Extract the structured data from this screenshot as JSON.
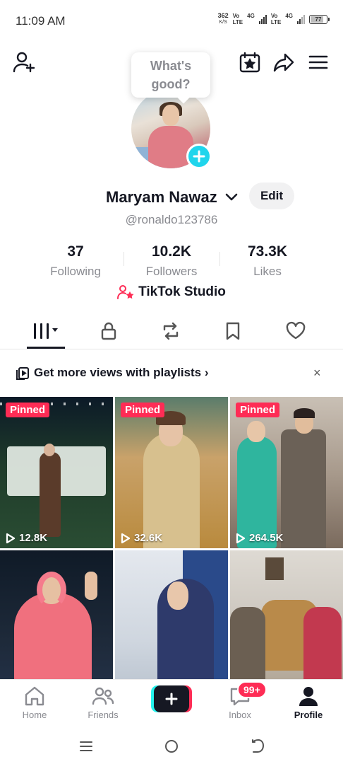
{
  "status_bar": {
    "time": "11:09 AM",
    "net_speed_value": "362",
    "net_speed_unit": "K/S",
    "sim1_label_top": "Vo",
    "sim1_label_bottom": "LTE",
    "sim1_network": "4G",
    "sim2_label_top": "Vo",
    "sim2_label_bottom": "LTE",
    "sim2_network": "4G",
    "battery_level": "77"
  },
  "header": {
    "left_icon": "add-friend-icon",
    "right_icons": [
      "calendar-star-icon",
      "share-icon",
      "menu-icon"
    ]
  },
  "profile": {
    "bubble_text_line1": "What's",
    "bubble_text_line2": "good?",
    "name": "Maryam Nawaz",
    "edit_label": "Edit",
    "handle": "@ronaldo123786",
    "stats": [
      {
        "value": "37",
        "label": "Following"
      },
      {
        "value": "10.2K",
        "label": "Followers"
      },
      {
        "value": "73.3K",
        "label": "Likes"
      }
    ],
    "studio_label": "TikTok Studio"
  },
  "tabs": [
    "videos-tab",
    "private-tab",
    "reposts-tab",
    "favorites-tab",
    "liked-tab"
  ],
  "banner": {
    "text": "Get more views with playlists",
    "chevron": "›",
    "close": "×"
  },
  "videos": [
    {
      "pinned_label": "Pinned",
      "views": "12.8K",
      "accent": "#1f3b2a"
    },
    {
      "pinned_label": "Pinned",
      "views": "32.6K",
      "accent": "#b98a3d"
    },
    {
      "pinned_label": "Pinned",
      "views": "264.5K",
      "accent": "#7a6a5d"
    },
    {
      "pinned_label": "",
      "views": "",
      "accent": "#1e2a3a"
    },
    {
      "pinned_label": "",
      "views": "",
      "accent": "#d9dde3"
    },
    {
      "pinned_label": "",
      "views": "",
      "accent": "#c9c3bb"
    }
  ],
  "bottom_nav": {
    "items": [
      {
        "label": "Home",
        "icon": "home-icon"
      },
      {
        "label": "Friends",
        "icon": "friends-icon"
      },
      {
        "label": "Inbox",
        "icon": "inbox-icon"
      },
      {
        "label": "Profile",
        "icon": "profile-icon"
      }
    ],
    "inbox_badge": "99+"
  },
  "colors": {
    "accent_red": "#fe2c55",
    "accent_cyan": "#25f4ee",
    "avatar_add": "#20d5ec"
  }
}
